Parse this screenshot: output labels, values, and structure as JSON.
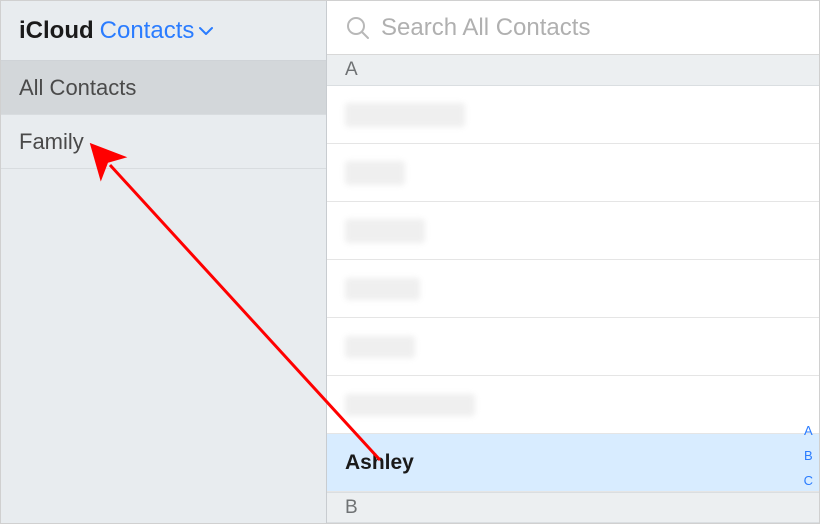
{
  "sidebar": {
    "brand": "iCloud",
    "dropdown_label": "Contacts",
    "groups": [
      {
        "label": "All Contacts",
        "selected": true
      },
      {
        "label": "Family",
        "selected": false
      }
    ]
  },
  "search": {
    "placeholder": "Search All Contacts"
  },
  "sections": [
    {
      "letter": "A"
    },
    {
      "letter": "B"
    }
  ],
  "contacts": {
    "selected_name": "Ashley"
  },
  "alpha_index": [
    "A",
    "B",
    "C"
  ]
}
